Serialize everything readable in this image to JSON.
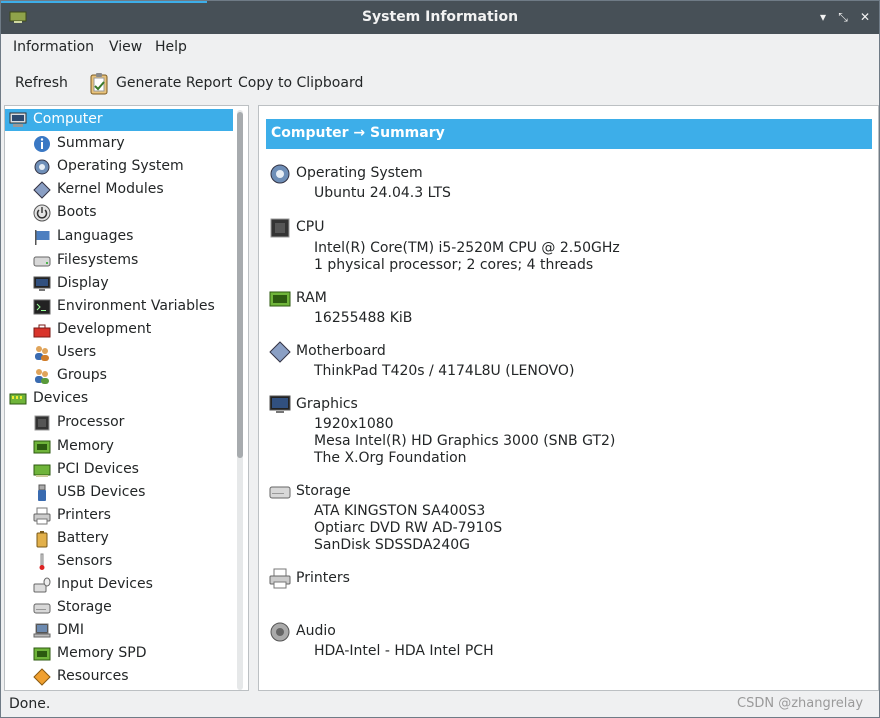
{
  "window": {
    "title": "System Information"
  },
  "menu": [
    "Information",
    "View",
    "Help"
  ],
  "toolbar": {
    "refresh": "Refresh",
    "generate_report": "Generate Report",
    "copy": "Copy to Clipboard"
  },
  "tree": {
    "computer": "Computer",
    "computer_items": [
      "Summary",
      "Operating System",
      "Kernel Modules",
      "Boots",
      "Languages",
      "Filesystems",
      "Display",
      "Environment Variables",
      "Development",
      "Users",
      "Groups"
    ],
    "devices": "Devices",
    "device_items": [
      "Processor",
      "Memory",
      "PCI Devices",
      "USB Devices",
      "Printers",
      "Battery",
      "Sensors",
      "Input Devices",
      "Storage",
      "DMI",
      "Memory SPD",
      "Resources"
    ]
  },
  "content": {
    "header": "Computer → Summary",
    "os": {
      "title": "Operating System",
      "lines": [
        "Ubuntu 24.04.3 LTS"
      ]
    },
    "cpu": {
      "title": "CPU",
      "lines": [
        "Intel(R) Core(TM) i5-2520M CPU @ 2.50GHz",
        "1 physical processor; 2 cores; 4 threads"
      ]
    },
    "ram": {
      "title": "RAM",
      "lines": [
        "16255488 KiB"
      ]
    },
    "mb": {
      "title": "Motherboard",
      "lines": [
        "ThinkPad T420s / 4174L8U (LENOVO)"
      ]
    },
    "gfx": {
      "title": "Graphics",
      "lines": [
        "1920x1080",
        "Mesa Intel(R) HD Graphics 3000 (SNB GT2)",
        "The X.Org Foundation"
      ]
    },
    "storage": {
      "title": "Storage",
      "lines": [
        "ATA KINGSTON SA400S3",
        "Optiarc DVD RW AD-7910S",
        "SanDisk SDSSDA240G"
      ]
    },
    "printers": {
      "title": "Printers",
      "lines": []
    },
    "audio": {
      "title": "Audio",
      "lines": [
        "HDA-Intel - HDA Intel PCH"
      ]
    }
  },
  "status": "Done.",
  "watermark": "CSDN @zhangrelay",
  "colors": {
    "accent": "#3daee9",
    "titlebar": "#475057"
  }
}
